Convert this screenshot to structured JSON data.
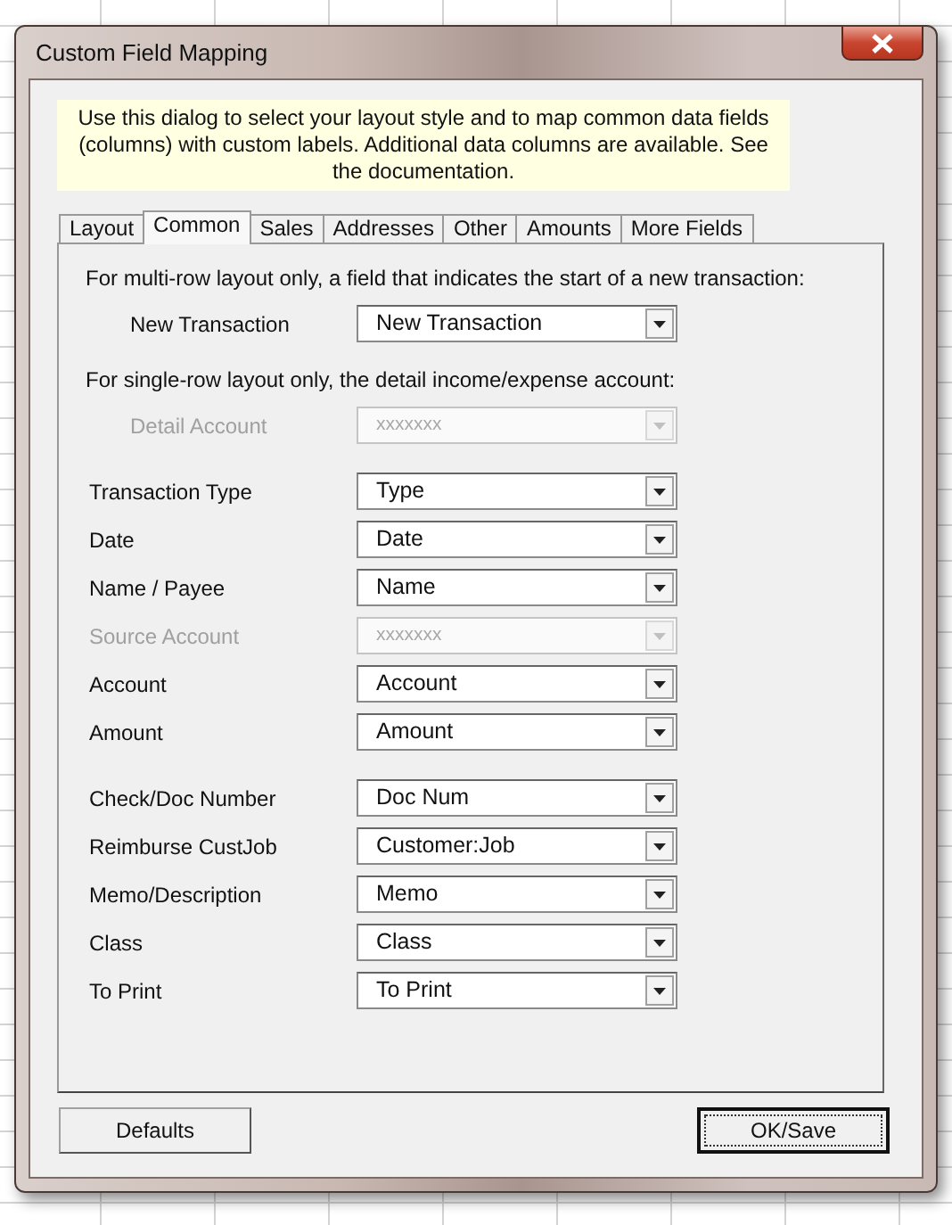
{
  "window": {
    "title": "Custom Field Mapping"
  },
  "note": "Use this dialog to select your layout style and to map common data fields (columns) with custom labels. Additional data columns are available. See the documentation.",
  "tabs": [
    {
      "label": "Layout",
      "selected": false
    },
    {
      "label": "Common",
      "selected": true
    },
    {
      "label": "Sales",
      "selected": false
    },
    {
      "label": "Addresses",
      "selected": false
    },
    {
      "label": "Other",
      "selected": false
    },
    {
      "label": "Amounts",
      "selected": false
    },
    {
      "label": "More Fields",
      "selected": false
    }
  ],
  "groups": [
    {
      "heading": "For multi-row layout only, a field that indicates the start of a new transaction:",
      "fields": [
        {
          "label": "New Transaction",
          "value": "New Transaction",
          "disabled": false
        }
      ]
    },
    {
      "heading": "For single-row layout only, the detail income/expense account:",
      "fields": [
        {
          "label": "Detail Account",
          "value": "xxxxxxx",
          "disabled": true
        }
      ]
    },
    {
      "fields": [
        {
          "label": "Transaction Type",
          "value": "Type",
          "disabled": false
        },
        {
          "label": "Date",
          "value": "Date",
          "disabled": false
        },
        {
          "label": "Name / Payee",
          "value": "Name",
          "disabled": false
        },
        {
          "label": "Source Account",
          "value": "xxxxxxx",
          "disabled": true
        },
        {
          "label": "Account",
          "value": "Account",
          "disabled": false
        },
        {
          "label": "Amount",
          "value": "Amount",
          "disabled": false
        }
      ]
    },
    {
      "fields": [
        {
          "label": "Check/Doc Number",
          "value": "Doc Num",
          "disabled": false
        },
        {
          "label": "Reimburse CustJob",
          "value": "Customer:Job",
          "disabled": false
        },
        {
          "label": "Memo/Description",
          "value": "Memo",
          "disabled": false
        },
        {
          "label": "Class",
          "value": "Class",
          "disabled": false
        },
        {
          "label": "To Print",
          "value": "To Print",
          "disabled": false
        }
      ]
    }
  ],
  "buttons": [
    {
      "label": "Defaults",
      "focused": false
    },
    {
      "label": "OK/Save",
      "focused": true
    }
  ]
}
